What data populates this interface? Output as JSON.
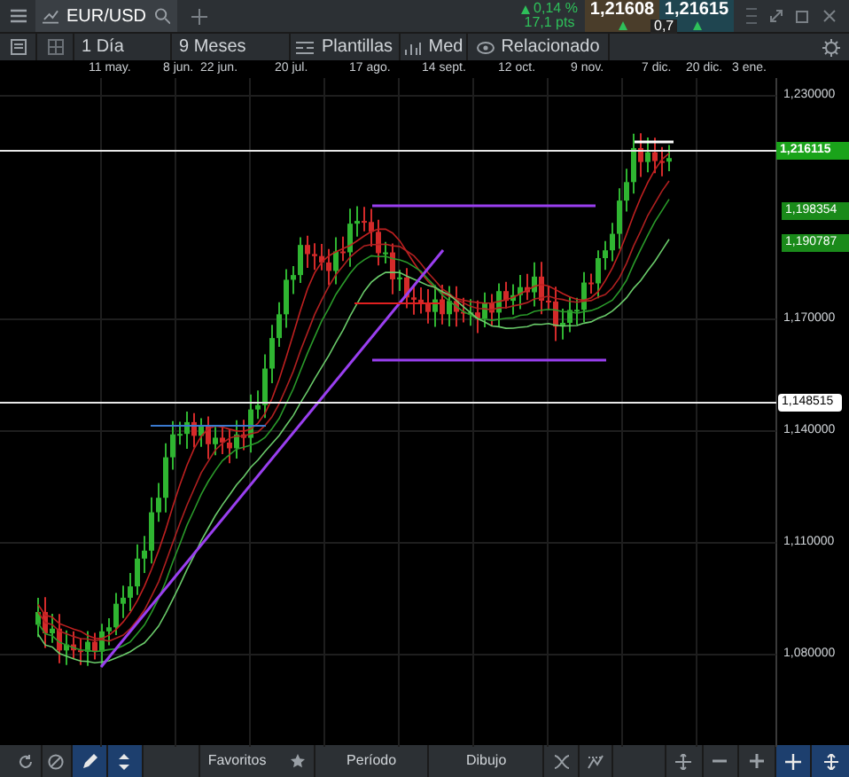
{
  "header": {
    "symbol": "EUR/USD",
    "change": "0,14 %",
    "change_points": "17,1 pts",
    "bid": "1,21608",
    "ask": "1,21615",
    "spread": "0,7"
  },
  "toolbar": [
    {
      "label": "1 Día",
      "kind": "text"
    },
    {
      "label": "9 Meses",
      "kind": "text"
    },
    {
      "label": "Plantillas",
      "kind": "templates"
    },
    {
      "label": "Med",
      "kind": "studies"
    },
    {
      "label": "Relacionado",
      "kind": "related"
    }
  ],
  "date_axis": [
    "11 may.",
    "8 jun.",
    "22 jun.",
    "20 jul.",
    "17 ago.",
    "14 sept.",
    "12 oct.",
    "9 nov.",
    "7 dic.",
    "20 dic.",
    "3 ene."
  ],
  "price_axis": [
    "1,230000",
    "1,170000",
    "1,140000",
    "1,110000",
    "1,080000"
  ],
  "price_tags": [
    {
      "text": "1,216115",
      "kind": "current"
    },
    {
      "text": "1,198354",
      "kind": "average"
    },
    {
      "text": "1,190787",
      "kind": "average"
    },
    {
      "text": "1,148515",
      "kind": "line"
    }
  ],
  "bottom_bar": {
    "tools": [
      {
        "kind": "pencil",
        "selected": true
      },
      {
        "kind": "arrows",
        "selected": true
      }
    ],
    "favorites": "Favoritos",
    "period": "Período",
    "drawing": "Dibujo",
    "crosshair_selected": true
  }
}
